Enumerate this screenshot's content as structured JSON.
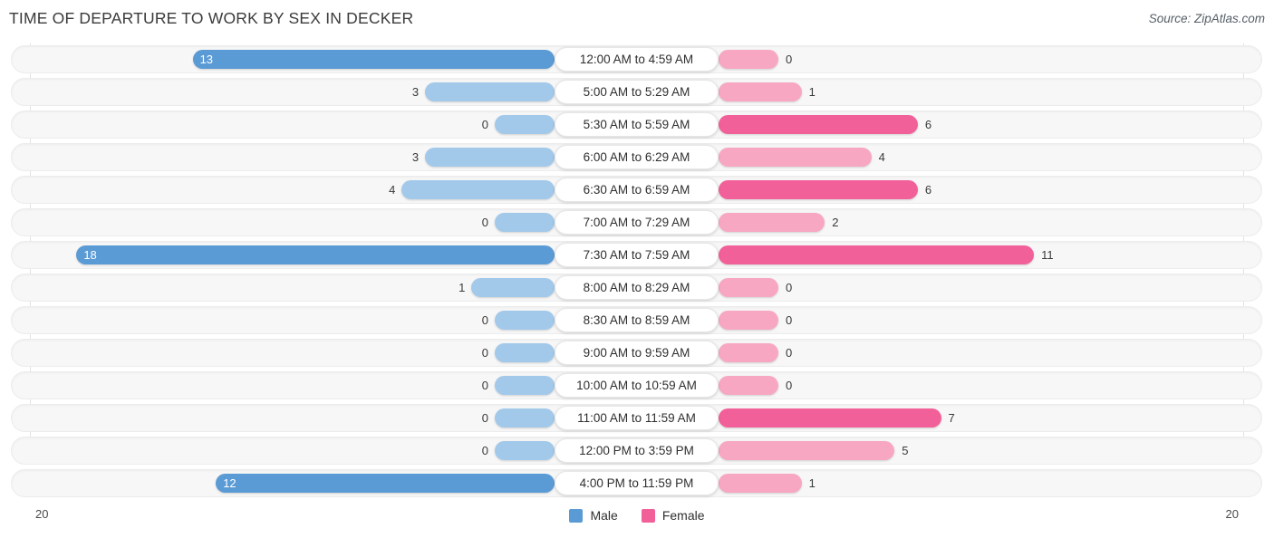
{
  "header": {
    "title": "TIME OF DEPARTURE TO WORK BY SEX IN DECKER",
    "source": "Source: ZipAtlas.com"
  },
  "legend": {
    "male_label": "Male",
    "female_label": "Female",
    "male_color": "#5b9bd5",
    "female_color": "#f2609a"
  },
  "axis": {
    "left_tick": "20",
    "right_tick": "20",
    "max": 20
  },
  "colors": {
    "male_light": "#a2c9ea",
    "male_dark": "#5b9bd5",
    "female_light": "#f8a7c2",
    "female_dark": "#f2609a",
    "track_bg": "#f7f7f7",
    "gridline": "#e2e2e2"
  },
  "chart_data": {
    "type": "bar",
    "orientation": "horizontal-diverging",
    "title": "TIME OF DEPARTURE TO WORK BY SEX IN DECKER",
    "xlabel": "",
    "ylabel": "",
    "xlim": [
      20,
      20
    ],
    "grid": true,
    "legend_position": "bottom-center",
    "categories": [
      "12:00 AM to 4:59 AM",
      "5:00 AM to 5:29 AM",
      "5:30 AM to 5:59 AM",
      "6:00 AM to 6:29 AM",
      "6:30 AM to 6:59 AM",
      "7:00 AM to 7:29 AM",
      "7:30 AM to 7:59 AM",
      "8:00 AM to 8:29 AM",
      "8:30 AM to 8:59 AM",
      "9:00 AM to 9:59 AM",
      "10:00 AM to 10:59 AM",
      "11:00 AM to 11:59 AM",
      "12:00 PM to 3:59 PM",
      "4:00 PM to 11:59 PM"
    ],
    "series": [
      {
        "name": "Male",
        "values": [
          13,
          3,
          0,
          3,
          4,
          0,
          18,
          1,
          0,
          0,
          0,
          0,
          0,
          12
        ]
      },
      {
        "name": "Female",
        "values": [
          0,
          1,
          6,
          4,
          6,
          2,
          11,
          0,
          0,
          0,
          0,
          7,
          5,
          1
        ]
      }
    ]
  },
  "rows": [
    {
      "label": "12:00 AM to 4:59 AM",
      "male": "13",
      "female": "0"
    },
    {
      "label": "5:00 AM to 5:29 AM",
      "male": "3",
      "female": "1"
    },
    {
      "label": "5:30 AM to 5:59 AM",
      "male": "0",
      "female": "6"
    },
    {
      "label": "6:00 AM to 6:29 AM",
      "male": "3",
      "female": "4"
    },
    {
      "label": "6:30 AM to 6:59 AM",
      "male": "4",
      "female": "6"
    },
    {
      "label": "7:00 AM to 7:29 AM",
      "male": "0",
      "female": "2"
    },
    {
      "label": "7:30 AM to 7:59 AM",
      "male": "18",
      "female": "11"
    },
    {
      "label": "8:00 AM to 8:29 AM",
      "male": "1",
      "female": "0"
    },
    {
      "label": "8:30 AM to 8:59 AM",
      "male": "0",
      "female": "0"
    },
    {
      "label": "9:00 AM to 9:59 AM",
      "male": "0",
      "female": "0"
    },
    {
      "label": "10:00 AM to 10:59 AM",
      "male": "0",
      "female": "0"
    },
    {
      "label": "11:00 AM to 11:59 AM",
      "male": "0",
      "female": "7"
    },
    {
      "label": "12:00 PM to 3:59 PM",
      "male": "0",
      "female": "5"
    },
    {
      "label": "4:00 PM to 11:59 PM",
      "male": "12",
      "female": "1"
    }
  ]
}
